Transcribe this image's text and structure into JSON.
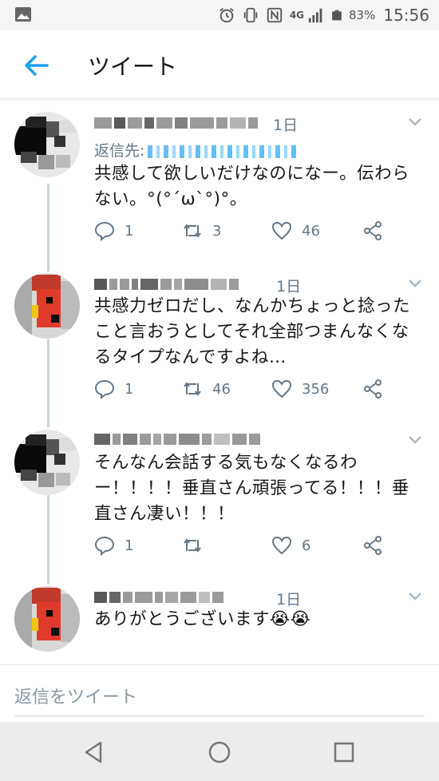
{
  "status_bar": {
    "network": "4G",
    "battery": "83%",
    "time": "15:56",
    "icons": [
      "image-icon",
      "alarm-icon",
      "vibrate-icon",
      "nfc-icon",
      "signal-icon",
      "battery-icon"
    ]
  },
  "app_bar": {
    "title": "ツイート",
    "back_icon": "arrow-left-icon"
  },
  "tweets": [
    {
      "time": "1日",
      "reply_to_label": "返信先:",
      "text": "共感して欲しいだけなのになー。伝わらない。°(°´ω`°)°。",
      "replies": "1",
      "retweets": "3",
      "likes": "46"
    },
    {
      "time": "1日",
      "text": "共感力ゼロだし、なんかちょっと捻ったこと言おうとしてそれ全部つまんなくなるタイプなんですよね…",
      "replies": "1",
      "retweets": "46",
      "likes": "356"
    },
    {
      "time": "",
      "text": "そんなん会話する気もなくなるわー！！！！垂直さん頑張ってる！！！垂直さん凄い！！！",
      "replies": "1",
      "retweets": "",
      "likes": "6"
    },
    {
      "time": "1日",
      "text": "ありがとうございます😭😭"
    }
  ],
  "reply_bar": {
    "placeholder": "返信をツイート"
  },
  "colors": {
    "accent": "#1da1f2",
    "muted": "#657786",
    "text": "#14171a"
  }
}
